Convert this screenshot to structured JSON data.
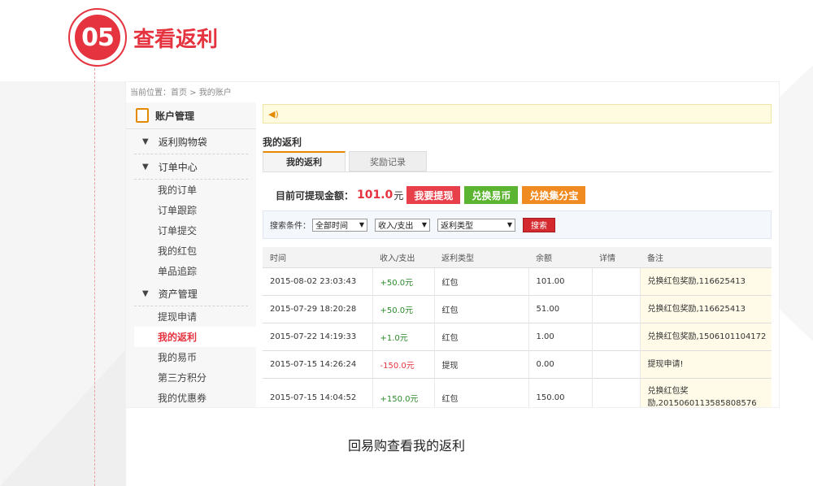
{
  "step": {
    "number": "05",
    "title": "查看返利"
  },
  "caption": "回易购查看我的返利",
  "colors": {
    "accent": "#e5333f",
    "orange": "#e58a00",
    "green": "#5cb531"
  },
  "breadcrumb": "当前位置：首页 > 我的账户",
  "sidebar": {
    "header": "账户管理",
    "header_icon": "clipboard-icon",
    "sections": [
      {
        "label": "返利购物袋",
        "items": []
      },
      {
        "label": "订单中心",
        "items": [
          "我的订单",
          "订单跟踪",
          "订单提交",
          "我的红包",
          "单品追踪"
        ]
      },
      {
        "label": "资产管理",
        "items": [
          "提现申请",
          "我的返利",
          "我的易币",
          "第三方积分",
          "我的优惠券"
        ]
      }
    ],
    "active_item": "我的返利"
  },
  "notice": {
    "icon": "speaker-icon",
    "text": ""
  },
  "section_title": "我的返利",
  "tabs": [
    "我的返利",
    "奖励记录"
  ],
  "balance": {
    "label": "目前可提现金额：",
    "value": "101.0",
    "unit": "元",
    "buttons": [
      "我要提现",
      "兑换易币",
      "兑换集分宝"
    ]
  },
  "search": {
    "label": "搜索条件：",
    "selects": [
      "全部时间",
      "收入/支出",
      "返利类型"
    ],
    "button": "搜索"
  },
  "table": {
    "headers": [
      "时间",
      "收入/支出",
      "返利类型",
      "余额",
      "详情",
      "备注"
    ],
    "rows": [
      [
        "2015-08-02 23:03:43",
        "+50.0元",
        "红包",
        "101.00",
        "",
        "兑换红包奖励,116625413"
      ],
      [
        "2015-07-29 18:20:28",
        "+50.0元",
        "红包",
        "51.00",
        "",
        "兑换红包奖励,116625413"
      ],
      [
        "2015-07-22 14:19:33",
        "+1.0元",
        "红包",
        "1.00",
        "",
        "兑换红包奖励,1506101104172"
      ],
      [
        "2015-07-15 14:26:24",
        "-150.0元",
        "提现",
        "0.00",
        "",
        "提现申请!"
      ],
      [
        "2015-07-15 14:04:52",
        "+150.0元",
        "红包",
        "150.00",
        "",
        "兑换红包奖励,2015060113585808576"
      ]
    ]
  }
}
